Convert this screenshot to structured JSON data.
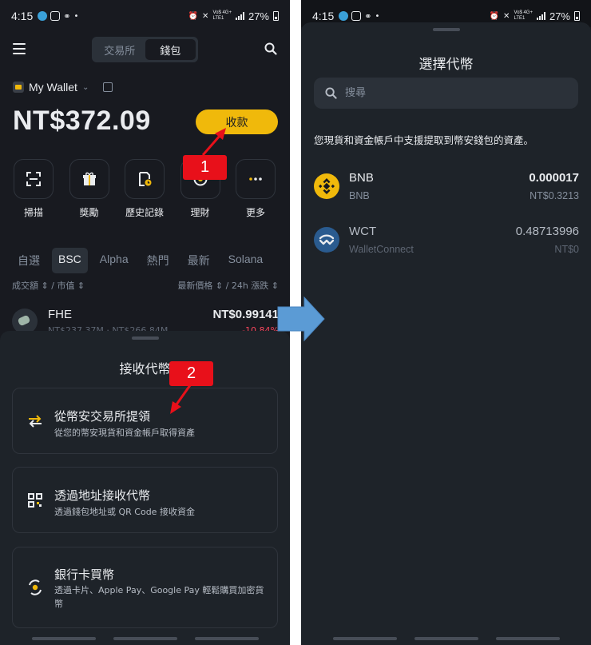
{
  "status": {
    "time": "4:15",
    "network": "Vo$ 4G+",
    "network_sub": "LTE1",
    "battery": "27%"
  },
  "left": {
    "segmented": {
      "exchange": "交易所",
      "wallet": "錢包"
    },
    "wallet_name": "My Wallet",
    "balance": "NT$372.09",
    "receive_label": "收款",
    "actions": [
      {
        "label": "掃描",
        "icon": "scan-icon"
      },
      {
        "label": "獎勵",
        "icon": "gift-icon"
      },
      {
        "label": "歷史記錄",
        "icon": "history-icon"
      },
      {
        "label": "理財",
        "icon": "earn-icon"
      },
      {
        "label": "更多",
        "icon": "more-icon"
      }
    ],
    "tabs": [
      "自選",
      "BSC",
      "Alpha",
      "熱門",
      "最新",
      "Solana"
    ],
    "col_left": "成交額 ⇕ / 市值 ⇕",
    "col_right": "最新價格 ⇕ / 24h 漲跌 ⇕",
    "token": {
      "name": "FHE",
      "price": "NT$0.99141",
      "sub": "NT$237.37M · NT$266.84M",
      "change": "-10.84%"
    },
    "sheet": {
      "title": "接收代幣",
      "options": [
        {
          "title": "從幣安交易所提領",
          "subtitle": "從您的幣安現貨和資金帳戶取得資產"
        },
        {
          "title": "透過地址接收代幣",
          "subtitle": "透過錢包地址或 QR Code 接收資金"
        },
        {
          "title": "銀行卡買幣",
          "subtitle": "透過卡片、Apple Pay、Google Pay 輕鬆購買加密貨幣"
        }
      ]
    }
  },
  "right": {
    "title": "選擇代幣",
    "search_placeholder": "搜尋",
    "note": "您現貨和資金帳戶中支援提取到幣安錢包的資產。",
    "coins": [
      {
        "symbol": "BNB",
        "name": "BNB",
        "amount": "0.000017",
        "value": "NT$0.3213",
        "color": "#f0b90b"
      },
      {
        "symbol": "WCT",
        "name": "WalletConnect",
        "amount": "0.48713996",
        "value": "NT$0",
        "color": "#3b99fc"
      }
    ]
  },
  "annotations": {
    "badge1": "1",
    "badge2": "2"
  },
  "colors": {
    "accent": "#f0b90b",
    "background": "#181a20",
    "sheet": "#1e2329",
    "badge": "#e8101a",
    "arrow": "#5b9bd5"
  }
}
